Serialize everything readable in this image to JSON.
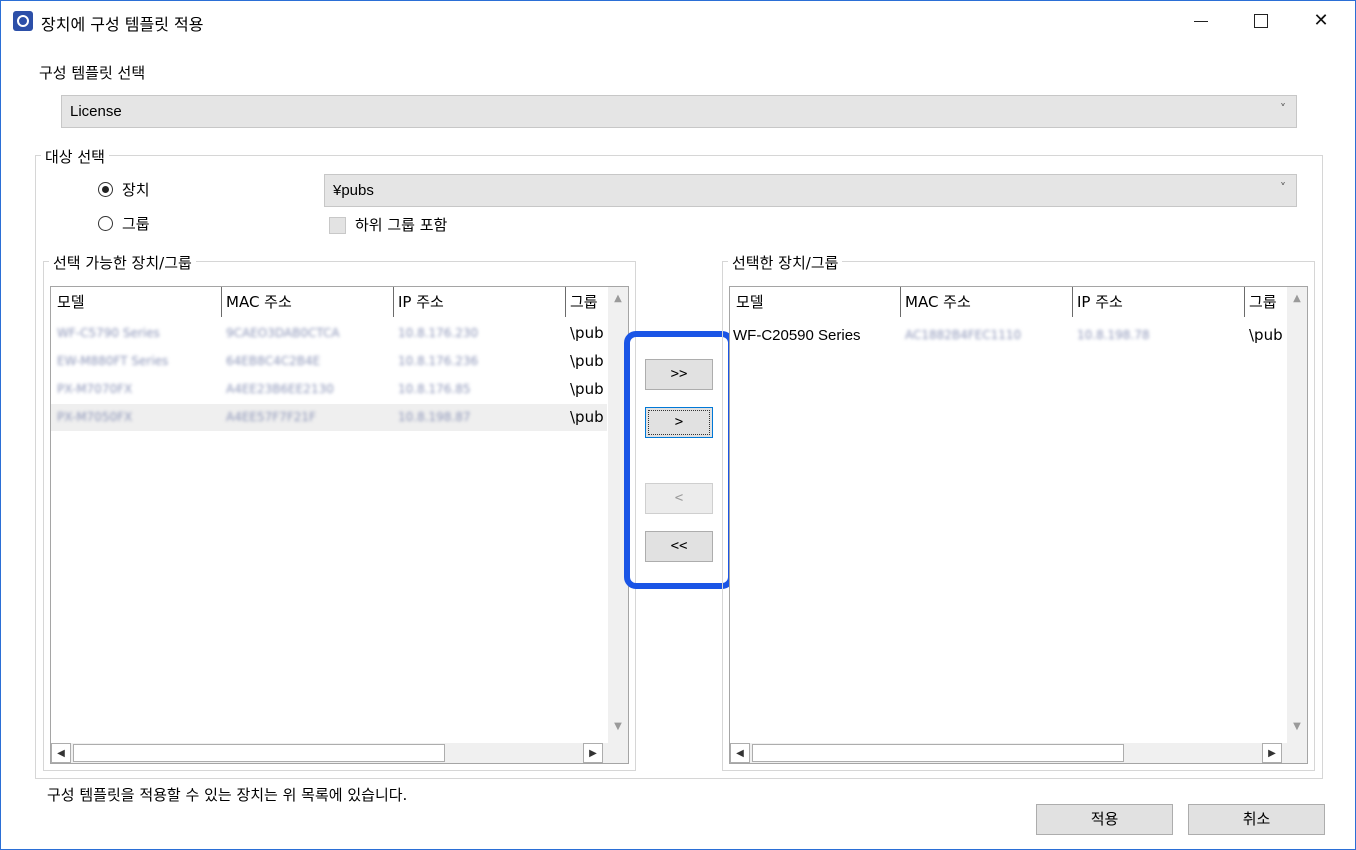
{
  "window": {
    "title": "장치에 구성 템플릿 적용",
    "minimize": "—",
    "maximize": "☐",
    "close": "✕"
  },
  "template_section": {
    "label": "구성 템플릿 선택",
    "selected": "License"
  },
  "target_section": {
    "label": "대상 선택",
    "device_radio": "장치",
    "group_radio": "그룹",
    "selected_radio": "장치",
    "path_selected": "¥pubs",
    "include_subgroups": "하위 그룹 포함",
    "include_subgroups_checked": false
  },
  "available": {
    "title": "선택 가능한 장치/그룹",
    "columns": [
      "모델",
      "MAC 주소",
      "IP 주소",
      "그룹"
    ],
    "rows": [
      {
        "model": "WF-C5790 Series",
        "mac": "9CAEO3DAB0CTCA",
        "ip": "10.8.176.230",
        "group": "\\pub"
      },
      {
        "model": "EW-M880FT Series",
        "mac": "64EB8C4C2B4E",
        "ip": "10.8.176.236",
        "group": "\\pub"
      },
      {
        "model": "PX-M7070FX",
        "mac": "A4EE23B6EE2130",
        "ip": "10.8.176.85",
        "group": "\\pub"
      },
      {
        "model": "PX-M7050FX",
        "mac": "A4EE57F7F21F",
        "ip": "10.8.198.87",
        "group": "\\pub"
      }
    ]
  },
  "selected": {
    "title": "선택한 장치/그룹",
    "columns": [
      "모델",
      "MAC 주소",
      "IP 주소",
      "그룹"
    ],
    "rows": [
      {
        "model": "WF-C20590 Series",
        "mac": "AC1882B4FEC1110",
        "ip": "10.8.198.78",
        "group": "\\pub"
      }
    ]
  },
  "move_buttons": {
    "add_all": ">>",
    "add": ">",
    "remove": "<",
    "remove_all": "<<"
  },
  "footer": {
    "note": "구성 템플릿을 적용할 수 있는 장치는 위 목록에 있습니다.",
    "apply": "적용",
    "cancel": "취소"
  },
  "colors": {
    "highlight": "#1a55e6",
    "window_border": "#2b6fd6"
  }
}
